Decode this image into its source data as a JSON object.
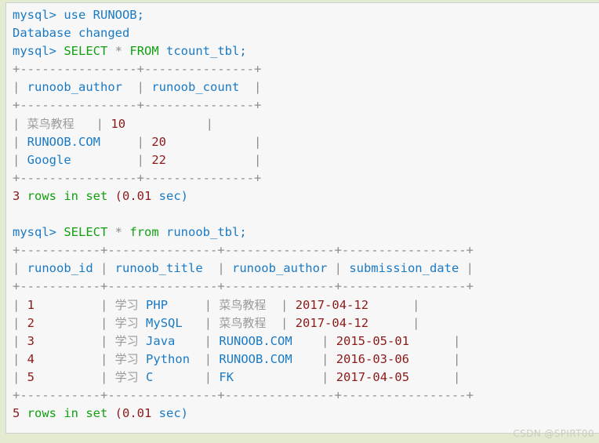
{
  "terminal": {
    "prompt": "mysql>",
    "watermark": "CSDN @SPIRT00",
    "lines": [
      {
        "id": "cmd-use",
        "segments": [
          {
            "t": "mysql> use RUNOOB;",
            "c": "ident"
          }
        ]
      },
      {
        "id": "msg-db-changed",
        "segments": [
          {
            "t": "Database changed",
            "c": "ident"
          }
        ]
      },
      {
        "id": "cmd-select-tcount",
        "segments": [
          {
            "t": "mysql> ",
            "c": "ident"
          },
          {
            "t": "SELECT",
            "c": "kw"
          },
          {
            "t": " ",
            "c": "plain"
          },
          {
            "t": "*",
            "c": "star"
          },
          {
            "t": " ",
            "c": "plain"
          },
          {
            "t": "FROM",
            "c": "kw"
          },
          {
            "t": " tcount_tbl;",
            "c": "ident"
          }
        ]
      },
      {
        "id": "t1-rule-top",
        "segments": [
          {
            "t": "+----------------+---------------+",
            "c": "rule"
          }
        ]
      },
      {
        "id": "t1-header",
        "segments": [
          {
            "t": "| ",
            "c": "rule"
          },
          {
            "t": "runoob_author",
            "c": "ident"
          },
          {
            "t": "  | ",
            "c": "rule"
          },
          {
            "t": "runoob_count",
            "c": "ident"
          },
          {
            "t": "  |",
            "c": "rule"
          }
        ]
      },
      {
        "id": "t1-rule-mid",
        "segments": [
          {
            "t": "+----------------+---------------+",
            "c": "rule"
          }
        ]
      },
      {
        "id": "t1-row-1",
        "segments": [
          {
            "t": "| ",
            "c": "rule"
          },
          {
            "t": "菜鸟教程",
            "c": "cjk"
          },
          {
            "t": "   | ",
            "c": "rule"
          },
          {
            "t": "10",
            "c": "num"
          },
          {
            "t": "           |",
            "c": "rule"
          }
        ]
      },
      {
        "id": "t1-row-2",
        "segments": [
          {
            "t": "| ",
            "c": "rule"
          },
          {
            "t": "RUNOOB.COM",
            "c": "ident"
          },
          {
            "t": "     | ",
            "c": "rule"
          },
          {
            "t": "20",
            "c": "num"
          },
          {
            "t": "            |",
            "c": "rule"
          }
        ]
      },
      {
        "id": "t1-row-3",
        "segments": [
          {
            "t": "| ",
            "c": "rule"
          },
          {
            "t": "Google",
            "c": "ident"
          },
          {
            "t": "         | ",
            "c": "rule"
          },
          {
            "t": "22",
            "c": "num"
          },
          {
            "t": "            |",
            "c": "rule"
          }
        ]
      },
      {
        "id": "t1-rule-bot",
        "segments": [
          {
            "t": "+----------------+---------------+",
            "c": "rule"
          }
        ]
      },
      {
        "id": "t1-status",
        "segments": [
          {
            "t": "3",
            "c": "num"
          },
          {
            "t": " rows in set ",
            "c": "kw"
          },
          {
            "t": "(0.01",
            "c": "num"
          },
          {
            "t": " sec)",
            "c": "ident"
          }
        ]
      },
      {
        "id": "blank-1",
        "segments": [
          {
            "t": " ",
            "c": "plain"
          }
        ]
      },
      {
        "id": "cmd-select-runoob",
        "segments": [
          {
            "t": "mysql> ",
            "c": "ident"
          },
          {
            "t": "SELECT",
            "c": "kw"
          },
          {
            "t": " ",
            "c": "plain"
          },
          {
            "t": "*",
            "c": "star"
          },
          {
            "t": " ",
            "c": "plain"
          },
          {
            "t": "from",
            "c": "kw"
          },
          {
            "t": " runoob_tbl;",
            "c": "ident"
          }
        ]
      },
      {
        "id": "t2-rule-top",
        "segments": [
          {
            "t": "+-----------+---------------+---------------+-----------------+",
            "c": "rule"
          }
        ]
      },
      {
        "id": "t2-header",
        "segments": [
          {
            "t": "| ",
            "c": "rule"
          },
          {
            "t": "runoob_id",
            "c": "ident"
          },
          {
            "t": " | ",
            "c": "rule"
          },
          {
            "t": "runoob_title",
            "c": "ident"
          },
          {
            "t": "  | ",
            "c": "rule"
          },
          {
            "t": "runoob_author",
            "c": "ident"
          },
          {
            "t": " | ",
            "c": "rule"
          },
          {
            "t": "submission_date",
            "c": "ident"
          },
          {
            "t": " |",
            "c": "rule"
          }
        ]
      },
      {
        "id": "t2-rule-mid",
        "segments": [
          {
            "t": "+-----------+---------------+---------------+-----------------+",
            "c": "rule"
          }
        ]
      },
      {
        "id": "t2-row-1",
        "segments": [
          {
            "t": "| ",
            "c": "rule"
          },
          {
            "t": "1",
            "c": "num"
          },
          {
            "t": "         | ",
            "c": "rule"
          },
          {
            "t": "学习",
            "c": "cjk"
          },
          {
            "t": " ",
            "c": "plain"
          },
          {
            "t": "PHP",
            "c": "ident"
          },
          {
            "t": "     | ",
            "c": "rule"
          },
          {
            "t": "菜鸟教程",
            "c": "cjk"
          },
          {
            "t": "  | ",
            "c": "rule"
          },
          {
            "t": "2017-04-12",
            "c": "num"
          },
          {
            "t": "      |",
            "c": "rule"
          }
        ]
      },
      {
        "id": "t2-row-2",
        "segments": [
          {
            "t": "| ",
            "c": "rule"
          },
          {
            "t": "2",
            "c": "num"
          },
          {
            "t": "         | ",
            "c": "rule"
          },
          {
            "t": "学习",
            "c": "cjk"
          },
          {
            "t": " ",
            "c": "plain"
          },
          {
            "t": "MySQL",
            "c": "ident"
          },
          {
            "t": "   | ",
            "c": "rule"
          },
          {
            "t": "菜鸟教程",
            "c": "cjk"
          },
          {
            "t": "  | ",
            "c": "rule"
          },
          {
            "t": "2017-04-12",
            "c": "num"
          },
          {
            "t": "      |",
            "c": "rule"
          }
        ]
      },
      {
        "id": "t2-row-3",
        "segments": [
          {
            "t": "| ",
            "c": "rule"
          },
          {
            "t": "3",
            "c": "num"
          },
          {
            "t": "         | ",
            "c": "rule"
          },
          {
            "t": "学习",
            "c": "cjk"
          },
          {
            "t": " ",
            "c": "plain"
          },
          {
            "t": "Java",
            "c": "ident"
          },
          {
            "t": "    | ",
            "c": "rule"
          },
          {
            "t": "RUNOOB.COM",
            "c": "ident"
          },
          {
            "t": "    | ",
            "c": "rule"
          },
          {
            "t": "2015-05-01",
            "c": "num"
          },
          {
            "t": "      |",
            "c": "rule"
          }
        ]
      },
      {
        "id": "t2-row-4",
        "segments": [
          {
            "t": "| ",
            "c": "rule"
          },
          {
            "t": "4",
            "c": "num"
          },
          {
            "t": "         | ",
            "c": "rule"
          },
          {
            "t": "学习",
            "c": "cjk"
          },
          {
            "t": " ",
            "c": "plain"
          },
          {
            "t": "Python",
            "c": "ident"
          },
          {
            "t": "  | ",
            "c": "rule"
          },
          {
            "t": "RUNOOB.COM",
            "c": "ident"
          },
          {
            "t": "    | ",
            "c": "rule"
          },
          {
            "t": "2016-03-06",
            "c": "num"
          },
          {
            "t": "      |",
            "c": "rule"
          }
        ]
      },
      {
        "id": "t2-row-5",
        "segments": [
          {
            "t": "| ",
            "c": "rule"
          },
          {
            "t": "5",
            "c": "num"
          },
          {
            "t": "         | ",
            "c": "rule"
          },
          {
            "t": "学习",
            "c": "cjk"
          },
          {
            "t": " ",
            "c": "plain"
          },
          {
            "t": "C",
            "c": "ident"
          },
          {
            "t": "       | ",
            "c": "rule"
          },
          {
            "t": "FK",
            "c": "ident"
          },
          {
            "t": "            | ",
            "c": "rule"
          },
          {
            "t": "2017-04-05",
            "c": "num"
          },
          {
            "t": "      |",
            "c": "rule"
          }
        ]
      },
      {
        "id": "t2-rule-bot",
        "segments": [
          {
            "t": "+-----------+---------------+---------------+-----------------+",
            "c": "rule"
          }
        ]
      },
      {
        "id": "t2-status",
        "segments": [
          {
            "t": "5",
            "c": "num"
          },
          {
            "t": " rows in set ",
            "c": "kw"
          },
          {
            "t": "(0.01",
            "c": "num"
          },
          {
            "t": " sec)",
            "c": "ident"
          }
        ]
      }
    ],
    "tables": [
      {
        "name": "tcount_tbl",
        "columns": [
          "runoob_author",
          "runoob_count"
        ],
        "rows": [
          [
            "菜鸟教程",
            "10"
          ],
          [
            "RUNOOB.COM",
            "20"
          ],
          [
            "Google",
            "22"
          ]
        ],
        "row_count": 3,
        "elapsed": "0.01 sec"
      },
      {
        "name": "runoob_tbl",
        "columns": [
          "runoob_id",
          "runoob_title",
          "runoob_author",
          "submission_date"
        ],
        "rows": [
          [
            "1",
            "学习 PHP",
            "菜鸟教程",
            "2017-04-12"
          ],
          [
            "2",
            "学习 MySQL",
            "菜鸟教程",
            "2017-04-12"
          ],
          [
            "3",
            "学习 Java",
            "RUNOOB.COM",
            "2015-05-01"
          ],
          [
            "4",
            "学习 Python",
            "RUNOOB.COM",
            "2016-03-06"
          ],
          [
            "5",
            "学习 C",
            "FK",
            "2017-04-05"
          ]
        ],
        "row_count": 5,
        "elapsed": "0.01 sec"
      }
    ]
  },
  "colors": {
    "page_background": "#e2ead0",
    "terminal_background": "#f7f7f7",
    "identifier": "#1a7ac4",
    "keyword": "#12a012",
    "number": "#8b1a1a",
    "muted": "#9a9a9a",
    "rule": "#8d8d8d",
    "watermark": "#c9cdbe"
  }
}
